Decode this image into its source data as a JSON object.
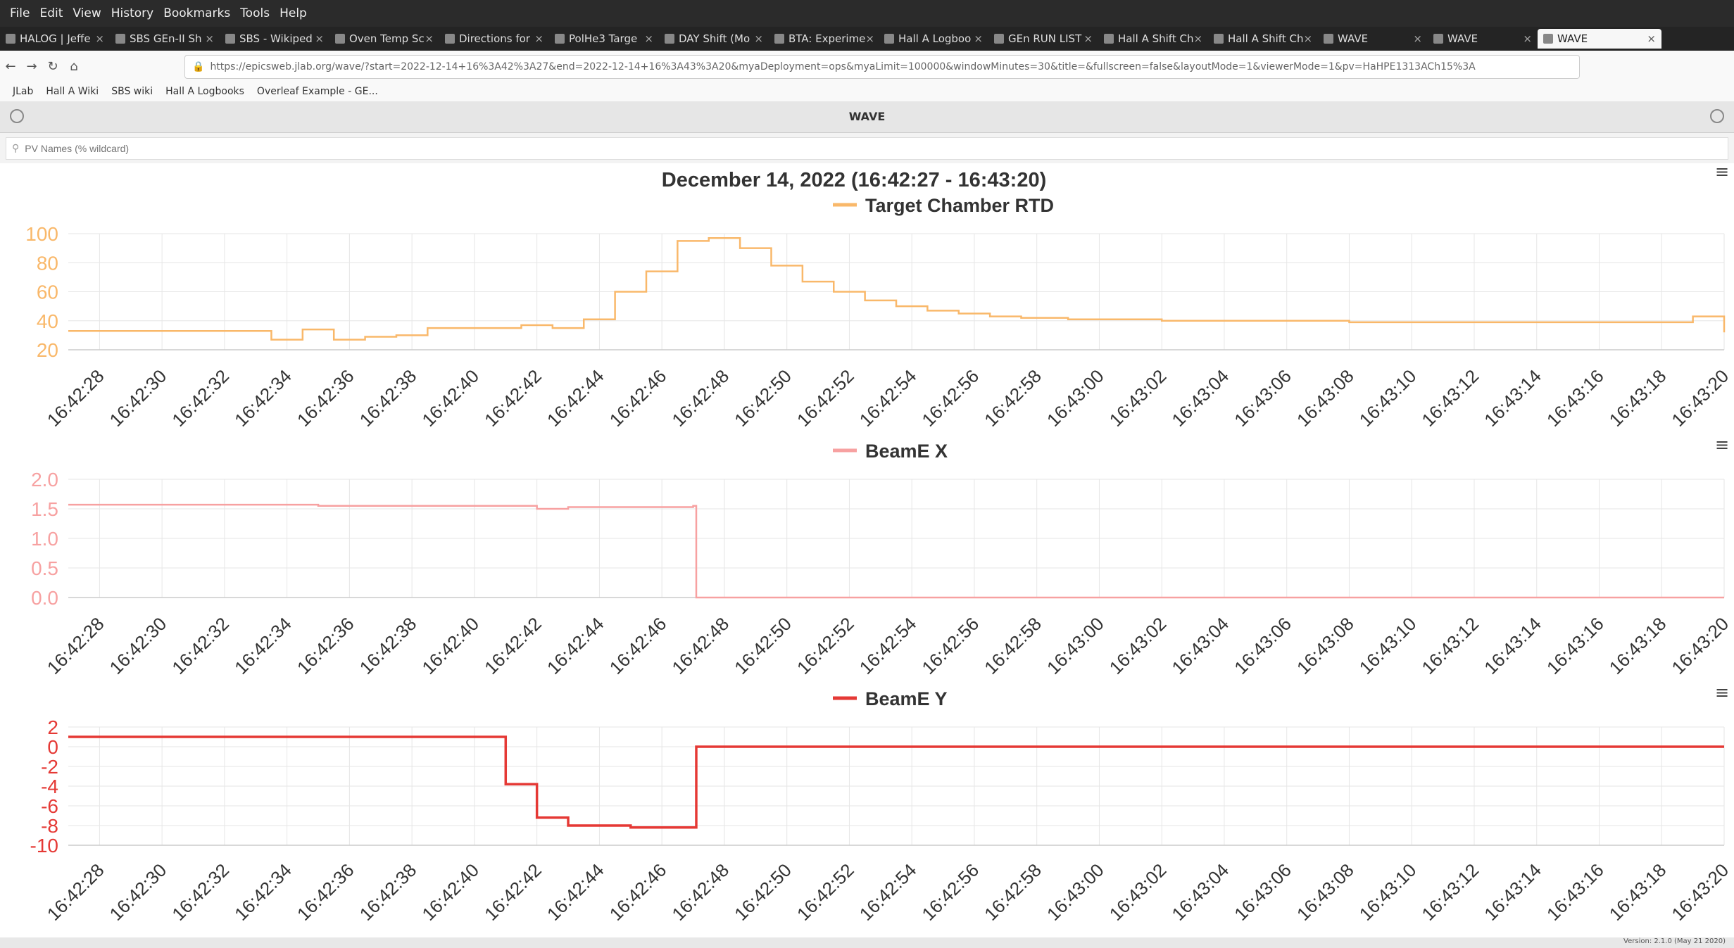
{
  "menubar": {
    "items": [
      "File",
      "Edit",
      "View",
      "History",
      "Bookmarks",
      "Tools",
      "Help"
    ]
  },
  "tabs": [
    {
      "label": "HALOG | Jeffe"
    },
    {
      "label": "SBS GEn-II Sh"
    },
    {
      "label": "SBS - Wikiped"
    },
    {
      "label": "Oven Temp Sc"
    },
    {
      "label": "Directions for"
    },
    {
      "label": "PolHe3 Targe"
    },
    {
      "label": "DAY Shift (Mo"
    },
    {
      "label": "BTA: Experime"
    },
    {
      "label": "Hall A Logboo"
    },
    {
      "label": "GEn RUN LIST"
    },
    {
      "label": "Hall A Shift Ch"
    },
    {
      "label": "Hall A Shift Ch"
    },
    {
      "label": "WAVE"
    },
    {
      "label": "WAVE"
    },
    {
      "label": "WAVE"
    }
  ],
  "url": "https://epicsweb.jlab.org/wave/?start=2022-12-14+16%3A42%3A27&end=2022-12-14+16%3A43%3A20&myaDeployment=ops&myaLimit=100000&windowMinutes=30&title=&fullscreen=false&layoutMode=1&viewerMode=1&pv=HaHPE1313ACh15%3A",
  "bookmarks": [
    "JLab",
    "Hall A Wiki",
    "SBS wiki",
    "Hall A Logbooks",
    "Overleaf Example - GE..."
  ],
  "app": {
    "title": "WAVE",
    "search_placeholder": "PV Names (% wildcard)",
    "version": "Version: 2.1.0 (May 21 2020)"
  },
  "chart_data": [
    {
      "type": "line",
      "title": "December 14, 2022 (16:42:27 - 16:43:20)",
      "series": [
        {
          "name": "Target Chamber RTD",
          "color": "#f9b86a",
          "x": [
            "16:42:27",
            "16:42:33.5",
            "16:42:34.5",
            "16:42:35.5",
            "16:42:36.5",
            "16:42:37.5",
            "16:42:38.5",
            "16:42:39.5",
            "16:42:41.5",
            "16:42:42.5",
            "16:42:43.5",
            "16:42:44.5",
            "16:42:45.5",
            "16:42:46.5",
            "16:42:47.5",
            "16:42:48.5",
            "16:42:49.5",
            "16:42:50.5",
            "16:42:51.5",
            "16:42:52.5",
            "16:42:53.5",
            "16:42:54.5",
            "16:42:55.5",
            "16:42:56.5",
            "16:42:57.5",
            "16:42:59",
            "16:43:02",
            "16:43:08",
            "16:43:19",
            "16:43:20"
          ],
          "y": [
            33,
            27,
            34,
            27,
            29,
            30,
            35,
            35,
            37,
            35,
            41,
            60,
            74,
            95,
            97,
            90,
            78,
            67,
            60,
            54,
            50,
            47,
            45,
            43,
            42,
            41,
            40,
            39,
            43,
            32
          ]
        }
      ],
      "x_ticks": [
        "16:42:28",
        "16:42:30",
        "16:42:32",
        "16:42:34",
        "16:42:36",
        "16:42:38",
        "16:42:40",
        "16:42:42",
        "16:42:44",
        "16:42:46",
        "16:42:48",
        "16:42:50",
        "16:42:52",
        "16:42:54",
        "16:42:56",
        "16:42:58",
        "16:43:00",
        "16:43:02",
        "16:43:04",
        "16:43:06",
        "16:43:08",
        "16:43:10",
        "16:43:12",
        "16:43:14",
        "16:43:16",
        "16:43:18",
        "16:43:20"
      ],
      "y_ticks": [
        "100",
        "80",
        "60",
        "40",
        "20"
      ],
      "ylim": [
        20,
        100
      ]
    },
    {
      "type": "line",
      "series": [
        {
          "name": "BeamE X",
          "color": "#f7a1a1",
          "x": [
            "16:42:27",
            "16:42:35",
            "16:42:42",
            "16:42:43",
            "16:42:47",
            "16:42:47.1",
            "16:43:20"
          ],
          "y": [
            1.57,
            1.55,
            1.5,
            1.53,
            1.55,
            0.0,
            0.0
          ]
        }
      ],
      "x_ticks": [
        "16:42:28",
        "16:42:30",
        "16:42:32",
        "16:42:34",
        "16:42:36",
        "16:42:38",
        "16:42:40",
        "16:42:42",
        "16:42:44",
        "16:42:46",
        "16:42:48",
        "16:42:50",
        "16:42:52",
        "16:42:54",
        "16:42:56",
        "16:42:58",
        "16:43:00",
        "16:43:02",
        "16:43:04",
        "16:43:06",
        "16:43:08",
        "16:43:10",
        "16:43:12",
        "16:43:14",
        "16:43:16",
        "16:43:18",
        "16:43:20"
      ],
      "y_ticks": [
        "2.0",
        "1.5",
        "1.0",
        "0.5",
        "0.0"
      ],
      "ylim": [
        0,
        2
      ]
    },
    {
      "type": "line",
      "series": [
        {
          "name": "BeamE Y",
          "color": "#e53935",
          "x": [
            "16:42:27",
            "16:42:41",
            "16:42:42",
            "16:42:43",
            "16:42:45",
            "16:42:47",
            "16:42:47.1",
            "16:43:20"
          ],
          "y": [
            1.0,
            -3.8,
            -7.2,
            -8.0,
            -8.2,
            -8.2,
            0.0,
            0.0
          ]
        }
      ],
      "x_ticks": [
        "16:42:28",
        "16:42:30",
        "16:42:32",
        "16:42:34",
        "16:42:36",
        "16:42:38",
        "16:42:40",
        "16:42:42",
        "16:42:44",
        "16:42:46",
        "16:42:48",
        "16:42:50",
        "16:42:52",
        "16:42:54",
        "16:42:56",
        "16:42:58",
        "16:43:00",
        "16:43:02",
        "16:43:04",
        "16:43:06",
        "16:43:08",
        "16:43:10",
        "16:43:12",
        "16:43:14",
        "16:43:16",
        "16:43:18",
        "16:43:20"
      ],
      "y_ticks": [
        "2",
        "0",
        "-2",
        "-4",
        "-6",
        "-8",
        "-10"
      ],
      "ylim": [
        -10,
        2
      ]
    }
  ]
}
